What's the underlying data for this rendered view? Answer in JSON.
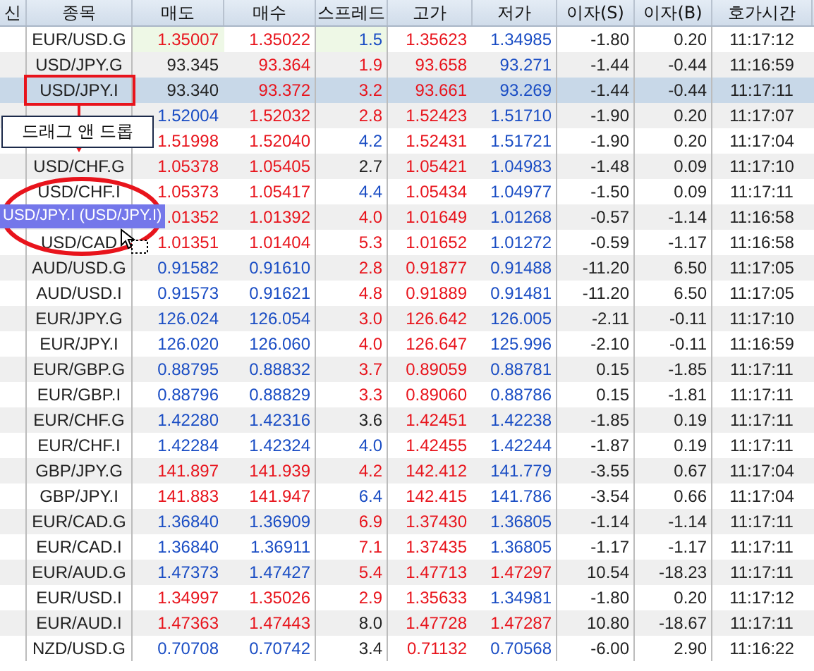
{
  "table": {
    "columns": [
      "신",
      "종목",
      "매도",
      "매수",
      "스프레드",
      "고가",
      "저가",
      "이자(S)",
      "이자(B)",
      "호가시간"
    ],
    "rows": [
      {
        "selected": false,
        "symbol": "EUR/USD.G",
        "sell": {
          "text": "1.35007",
          "color": "#e8141c",
          "highlight": true
        },
        "buy": {
          "text": "1.35022",
          "color": "#e8141c"
        },
        "spread": {
          "text": "1.5",
          "color": "#1a4dc4",
          "highlight": true
        },
        "high": {
          "text": "1.35623",
          "color": "#e8141c"
        },
        "low": {
          "text": "1.34985",
          "color": "#1a4dc4"
        },
        "swap_s": "-1.80",
        "swap_b": "0.20",
        "time": "11:17:12"
      },
      {
        "selected": false,
        "symbol": "USD/JPY.G",
        "sell": {
          "text": "93.345",
          "color": "#222222"
        },
        "buy": {
          "text": "93.364",
          "color": "#e8141c"
        },
        "spread": {
          "text": "1.9",
          "color": "#e8141c"
        },
        "high": {
          "text": "93.658",
          "color": "#e8141c"
        },
        "low": {
          "text": "93.271",
          "color": "#1a4dc4"
        },
        "swap_s": "-1.44",
        "swap_b": "-0.44",
        "time": "11:16:59"
      },
      {
        "selected": true,
        "symbol": "USD/JPY.I",
        "sell": {
          "text": "93.340",
          "color": "#222222"
        },
        "buy": {
          "text": "93.372",
          "color": "#e8141c"
        },
        "spread": {
          "text": "3.2",
          "color": "#e8141c"
        },
        "high": {
          "text": "93.661",
          "color": "#e8141c"
        },
        "low": {
          "text": "93.269",
          "color": "#1a4dc4"
        },
        "swap_s": "-1.44",
        "swap_b": "-0.44",
        "time": "11:17:11"
      },
      {
        "selected": false,
        "sell": {
          "text": "1.52004",
          "color": "#1a4dc4"
        },
        "buy": {
          "text": "1.52032",
          "color": "#e8141c"
        },
        "spread": {
          "text": "2.8",
          "color": "#e8141c"
        },
        "high": {
          "text": "1.52423",
          "color": "#e8141c"
        },
        "low": {
          "text": "1.51710",
          "color": "#1a4dc4"
        },
        "swap_s": "-1.90",
        "swap_b": "0.20",
        "time": "11:17:07"
      },
      {
        "selected": false,
        "sell": {
          "text": "1.51998",
          "color": "#e8141c"
        },
        "buy": {
          "text": "1.52040",
          "color": "#e8141c"
        },
        "spread": {
          "text": "4.2",
          "color": "#1a4dc4"
        },
        "high": {
          "text": "1.52431",
          "color": "#e8141c"
        },
        "low": {
          "text": "1.51721",
          "color": "#1a4dc4"
        },
        "swap_s": "-1.90",
        "swap_b": "0.20",
        "time": "11:17:04"
      },
      {
        "selected": false,
        "symbol": "USD/CHF.G",
        "sell": {
          "text": "1.05378",
          "color": "#e8141c"
        },
        "buy": {
          "text": "1.05405",
          "color": "#e8141c"
        },
        "spread": {
          "text": "2.7",
          "color": "#222222"
        },
        "high": {
          "text": "1.05421",
          "color": "#e8141c"
        },
        "low": {
          "text": "1.04983",
          "color": "#1a4dc4"
        },
        "swap_s": "-1.48",
        "swap_b": "0.09",
        "time": "11:17:10"
      },
      {
        "selected": false,
        "symbol": "USD/CHF.I",
        "sell": {
          "text": "1.05373",
          "color": "#e8141c"
        },
        "buy": {
          "text": "1.05417",
          "color": "#e8141c"
        },
        "spread": {
          "text": "4.4",
          "color": "#1a4dc4"
        },
        "high": {
          "text": "1.05434",
          "color": "#e8141c"
        },
        "low": {
          "text": "1.04977",
          "color": "#1a4dc4"
        },
        "swap_s": "-1.50",
        "swap_b": "0.09",
        "time": "11:17:11"
      },
      {
        "selected": false,
        "sell": {
          "text": ".01352",
          "color": "#e8141c"
        },
        "buy": {
          "text": "1.01392",
          "color": "#e8141c"
        },
        "spread": {
          "text": "4.0",
          "color": "#e8141c"
        },
        "high": {
          "text": "1.01649",
          "color": "#e8141c"
        },
        "low": {
          "text": "1.01268",
          "color": "#1a4dc4"
        },
        "swap_s": "-0.57",
        "swap_b": "-1.14",
        "time": "11:16:58"
      },
      {
        "selected": false,
        "symbol": "USD/CAD",
        "sell": {
          "text": "1.01351",
          "color": "#e8141c"
        },
        "buy": {
          "text": "1.01404",
          "color": "#e8141c"
        },
        "spread": {
          "text": "5.3",
          "color": "#e8141c"
        },
        "high": {
          "text": "1.01652",
          "color": "#e8141c"
        },
        "low": {
          "text": "1.01272",
          "color": "#1a4dc4"
        },
        "swap_s": "-0.59",
        "swap_b": "-1.17",
        "time": "11:16:58"
      },
      {
        "selected": false,
        "symbol": "AUD/USD.G",
        "sell": {
          "text": "0.91582",
          "color": "#1a4dc4"
        },
        "buy": {
          "text": "0.91610",
          "color": "#1a4dc4"
        },
        "spread": {
          "text": "2.8",
          "color": "#e8141c"
        },
        "high": {
          "text": "0.91877",
          "color": "#e8141c"
        },
        "low": {
          "text": "0.91488",
          "color": "#1a4dc4"
        },
        "swap_s": "-11.20",
        "swap_b": "6.50",
        "time": "11:17:05"
      },
      {
        "selected": false,
        "symbol": "AUD/USD.I",
        "sell": {
          "text": "0.91573",
          "color": "#1a4dc4"
        },
        "buy": {
          "text": "0.91621",
          "color": "#1a4dc4"
        },
        "spread": {
          "text": "4.8",
          "color": "#e8141c"
        },
        "high": {
          "text": "0.91889",
          "color": "#e8141c"
        },
        "low": {
          "text": "0.91481",
          "color": "#1a4dc4"
        },
        "swap_s": "-11.20",
        "swap_b": "6.50",
        "time": "11:17:05"
      },
      {
        "selected": false,
        "symbol": "EUR/JPY.G",
        "sell": {
          "text": "126.024",
          "color": "#1a4dc4"
        },
        "buy": {
          "text": "126.054",
          "color": "#1a4dc4"
        },
        "spread": {
          "text": "3.0",
          "color": "#e8141c"
        },
        "high": {
          "text": "126.642",
          "color": "#e8141c"
        },
        "low": {
          "text": "126.005",
          "color": "#1a4dc4"
        },
        "swap_s": "-2.11",
        "swap_b": "-0.11",
        "time": "11:17:10"
      },
      {
        "selected": false,
        "symbol": "EUR/JPY.I",
        "sell": {
          "text": "126.020",
          "color": "#1a4dc4"
        },
        "buy": {
          "text": "126.060",
          "color": "#1a4dc4"
        },
        "spread": {
          "text": "4.0",
          "color": "#e8141c"
        },
        "high": {
          "text": "126.647",
          "color": "#e8141c"
        },
        "low": {
          "text": "125.996",
          "color": "#1a4dc4"
        },
        "swap_s": "-2.10",
        "swap_b": "-0.11",
        "time": "11:16:59"
      },
      {
        "selected": false,
        "symbol": "EUR/GBP.G",
        "sell": {
          "text": "0.88795",
          "color": "#1a4dc4"
        },
        "buy": {
          "text": "0.88832",
          "color": "#1a4dc4"
        },
        "spread": {
          "text": "3.7",
          "color": "#e8141c"
        },
        "high": {
          "text": "0.89059",
          "color": "#e8141c"
        },
        "low": {
          "text": "0.88781",
          "color": "#1a4dc4"
        },
        "swap_s": "0.15",
        "swap_b": "-1.85",
        "time": "11:17:11"
      },
      {
        "selected": false,
        "symbol": "EUR/GBP.I",
        "sell": {
          "text": "0.88796",
          "color": "#1a4dc4"
        },
        "buy": {
          "text": "0.88829",
          "color": "#1a4dc4"
        },
        "spread": {
          "text": "3.3",
          "color": "#e8141c"
        },
        "high": {
          "text": "0.89060",
          "color": "#e8141c"
        },
        "low": {
          "text": "0.88786",
          "color": "#1a4dc4"
        },
        "swap_s": "0.15",
        "swap_b": "-1.81",
        "time": "11:17:11"
      },
      {
        "selected": false,
        "symbol": "EUR/CHF.G",
        "sell": {
          "text": "1.42280",
          "color": "#1a4dc4"
        },
        "buy": {
          "text": "1.42316",
          "color": "#1a4dc4"
        },
        "spread": {
          "text": "3.6",
          "color": "#222222"
        },
        "high": {
          "text": "1.42451",
          "color": "#e8141c"
        },
        "low": {
          "text": "1.42238",
          "color": "#1a4dc4"
        },
        "swap_s": "-1.85",
        "swap_b": "0.19",
        "time": "11:17:11"
      },
      {
        "selected": false,
        "symbol": "EUR/CHF.I",
        "sell": {
          "text": "1.42284",
          "color": "#1a4dc4"
        },
        "buy": {
          "text": "1.42324",
          "color": "#1a4dc4"
        },
        "spread": {
          "text": "4.0",
          "color": "#1a4dc4"
        },
        "high": {
          "text": "1.42455",
          "color": "#e8141c"
        },
        "low": {
          "text": "1.42244",
          "color": "#1a4dc4"
        },
        "swap_s": "-1.87",
        "swap_b": "0.19",
        "time": "11:17:11"
      },
      {
        "selected": false,
        "symbol": "GBP/JPY.G",
        "sell": {
          "text": "141.897",
          "color": "#e8141c"
        },
        "buy": {
          "text": "141.939",
          "color": "#e8141c"
        },
        "spread": {
          "text": "4.2",
          "color": "#e8141c"
        },
        "high": {
          "text": "142.412",
          "color": "#e8141c"
        },
        "low": {
          "text": "141.779",
          "color": "#1a4dc4"
        },
        "swap_s": "-3.55",
        "swap_b": "0.67",
        "time": "11:17:04"
      },
      {
        "selected": false,
        "symbol": "GBP/JPY.I",
        "sell": {
          "text": "141.883",
          "color": "#e8141c"
        },
        "buy": {
          "text": "141.947",
          "color": "#e8141c"
        },
        "spread": {
          "text": "6.4",
          "color": "#1a4dc4"
        },
        "high": {
          "text": "142.415",
          "color": "#e8141c"
        },
        "low": {
          "text": "141.786",
          "color": "#1a4dc4"
        },
        "swap_s": "-3.54",
        "swap_b": "0.66",
        "time": "11:17:04"
      },
      {
        "selected": false,
        "symbol": "EUR/CAD.G",
        "sell": {
          "text": "1.36840",
          "color": "#1a4dc4"
        },
        "buy": {
          "text": "1.36909",
          "color": "#1a4dc4"
        },
        "spread": {
          "text": "6.9",
          "color": "#e8141c"
        },
        "high": {
          "text": "1.37430",
          "color": "#e8141c"
        },
        "low": {
          "text": "1.36805",
          "color": "#1a4dc4"
        },
        "swap_s": "-1.14",
        "swap_b": "-1.14",
        "time": "11:17:11"
      },
      {
        "selected": false,
        "symbol": "EUR/CAD.I",
        "sell": {
          "text": "1.36840",
          "color": "#1a4dc4"
        },
        "buy": {
          "text": "1.36911",
          "color": "#1a4dc4"
        },
        "spread": {
          "text": "7.1",
          "color": "#e8141c"
        },
        "high": {
          "text": "1.37435",
          "color": "#e8141c"
        },
        "low": {
          "text": "1.36805",
          "color": "#1a4dc4"
        },
        "swap_s": "-1.17",
        "swap_b": "-1.17",
        "time": "11:17:11"
      },
      {
        "selected": false,
        "symbol": "EUR/AUD.G",
        "sell": {
          "text": "1.47373",
          "color": "#1a4dc4"
        },
        "buy": {
          "text": "1.47427",
          "color": "#1a4dc4"
        },
        "spread": {
          "text": "5.4",
          "color": "#e8141c"
        },
        "high": {
          "text": "1.47713",
          "color": "#e8141c"
        },
        "low": {
          "text": "1.47297",
          "color": "#e8141c"
        },
        "swap_s": "10.54",
        "swap_b": "-18.23",
        "time": "11:17:11"
      },
      {
        "selected": false,
        "symbol": "EUR/USD.I",
        "sell": {
          "text": "1.34997",
          "color": "#e8141c"
        },
        "buy": {
          "text": "1.35026",
          "color": "#e8141c"
        },
        "spread": {
          "text": "2.9",
          "color": "#e8141c"
        },
        "high": {
          "text": "1.35633",
          "color": "#e8141c"
        },
        "low": {
          "text": "1.34981",
          "color": "#1a4dc4"
        },
        "swap_s": "-1.80",
        "swap_b": "0.20",
        "time": "11:17:12"
      },
      {
        "selected": false,
        "symbol": "EUR/AUD.I",
        "sell": {
          "text": "1.47363",
          "color": "#e8141c"
        },
        "buy": {
          "text": "1.47443",
          "color": "#e8141c"
        },
        "spread": {
          "text": "8.0",
          "color": "#222222"
        },
        "high": {
          "text": "1.47728",
          "color": "#e8141c"
        },
        "low": {
          "text": "1.47287",
          "color": "#e8141c"
        },
        "swap_s": "10.80",
        "swap_b": "-18.67",
        "time": "11:17:11"
      },
      {
        "selected": false,
        "symbol": "NZD/USD.G",
        "sell": {
          "text": "0.70708",
          "color": "#1a4dc4"
        },
        "buy": {
          "text": "0.70742",
          "color": "#1a4dc4"
        },
        "spread": {
          "text": "3.4",
          "color": "#222222"
        },
        "high": {
          "text": "0.71132",
          "color": "#e8141c"
        },
        "low": {
          "text": "0.70568",
          "color": "#1a4dc4"
        },
        "swap_s": "-6.00",
        "swap_b": "2.90",
        "time": "11:16:22"
      }
    ]
  },
  "callout": {
    "text": "드래그 앤 드롭"
  },
  "drag_ghost": {
    "text": "USD/JPY.I (USD/JPY.I)"
  }
}
